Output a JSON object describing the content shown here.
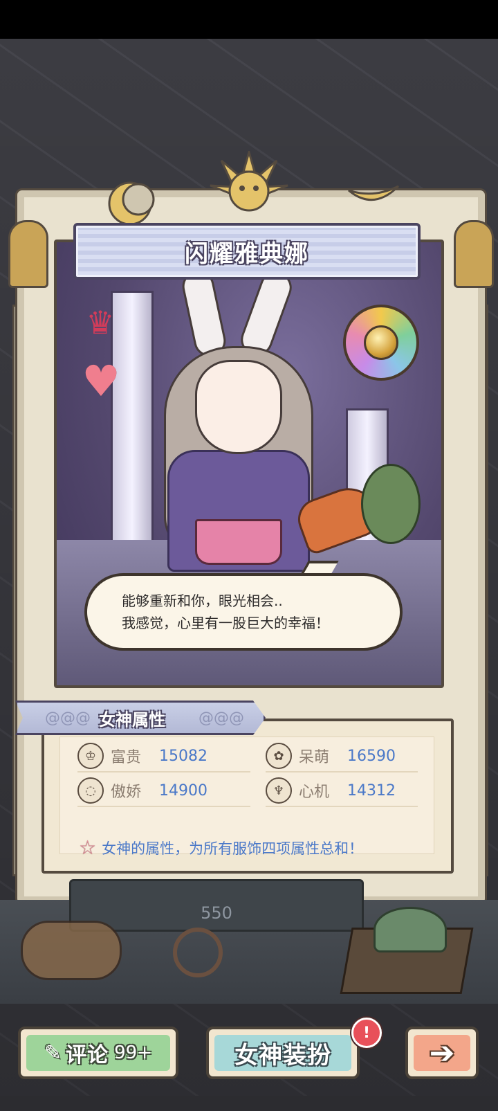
{
  "card": {
    "title": "闪耀雅典娜",
    "dialogue": {
      "line1": "能够重新和你，眼光相会..",
      "line2": "我感觉，心里有一股巨大的幸福！"
    }
  },
  "attributes": {
    "tab_label": "女神属性",
    "stats": [
      {
        "name": "富贵",
        "value": "15082",
        "icon": "crown-face-icon"
      },
      {
        "name": "呆萌",
        "value": "16590",
        "icon": "bow-face-icon"
      },
      {
        "name": "傲娇",
        "value": "14900",
        "icon": "halo-face-icon"
      },
      {
        "name": "心机",
        "value": "14312",
        "icon": "horn-face-icon"
      }
    ],
    "note": "女神的属性，为所有服饰四项属性总和！"
  },
  "background_counter": "550",
  "buttons": {
    "comment_label": "评论",
    "comment_count": "99+",
    "dress_label": "女神装扮",
    "dress_badge": "!",
    "next_icon": "arrow-right-icon"
  },
  "colors": {
    "stat_value": "#4a78c8",
    "comment_button": "#9ed49a",
    "dress_button": "#a7d8d8",
    "next_button": "#f3a68a",
    "alert": "#e8505a"
  }
}
